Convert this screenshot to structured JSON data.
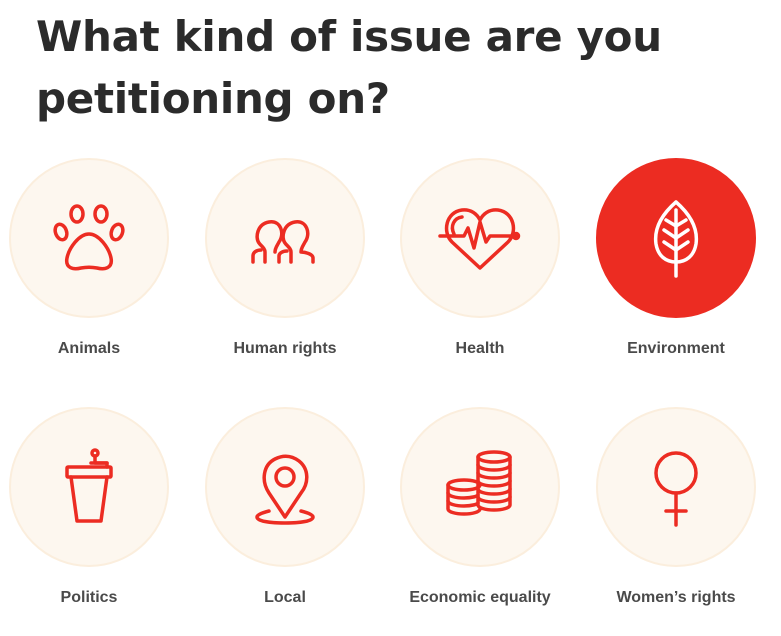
{
  "heading": "What kind of issue are you petitioning on?",
  "colors": {
    "accent": "#ec2c22",
    "circle_bg": "#fdf7ef",
    "circle_border": "#fbeedd",
    "label_text": "#4a4a4a",
    "heading_text": "#2b2b2b"
  },
  "selected_category": "Environment",
  "categories": [
    {
      "label": "Animals",
      "icon": "paw-icon",
      "selected": false
    },
    {
      "label": "Human rights",
      "icon": "people-icon",
      "selected": false
    },
    {
      "label": "Health",
      "icon": "heart-pulse-icon",
      "selected": false
    },
    {
      "label": "Environment",
      "icon": "leaf-icon",
      "selected": true
    },
    {
      "label": "Politics",
      "icon": "podium-icon",
      "selected": false
    },
    {
      "label": "Local",
      "icon": "map-pin-icon",
      "selected": false
    },
    {
      "label": "Economic equality",
      "icon": "coins-icon",
      "selected": false
    },
    {
      "label": "Women’s rights",
      "icon": "female-symbol-icon",
      "selected": false
    }
  ]
}
